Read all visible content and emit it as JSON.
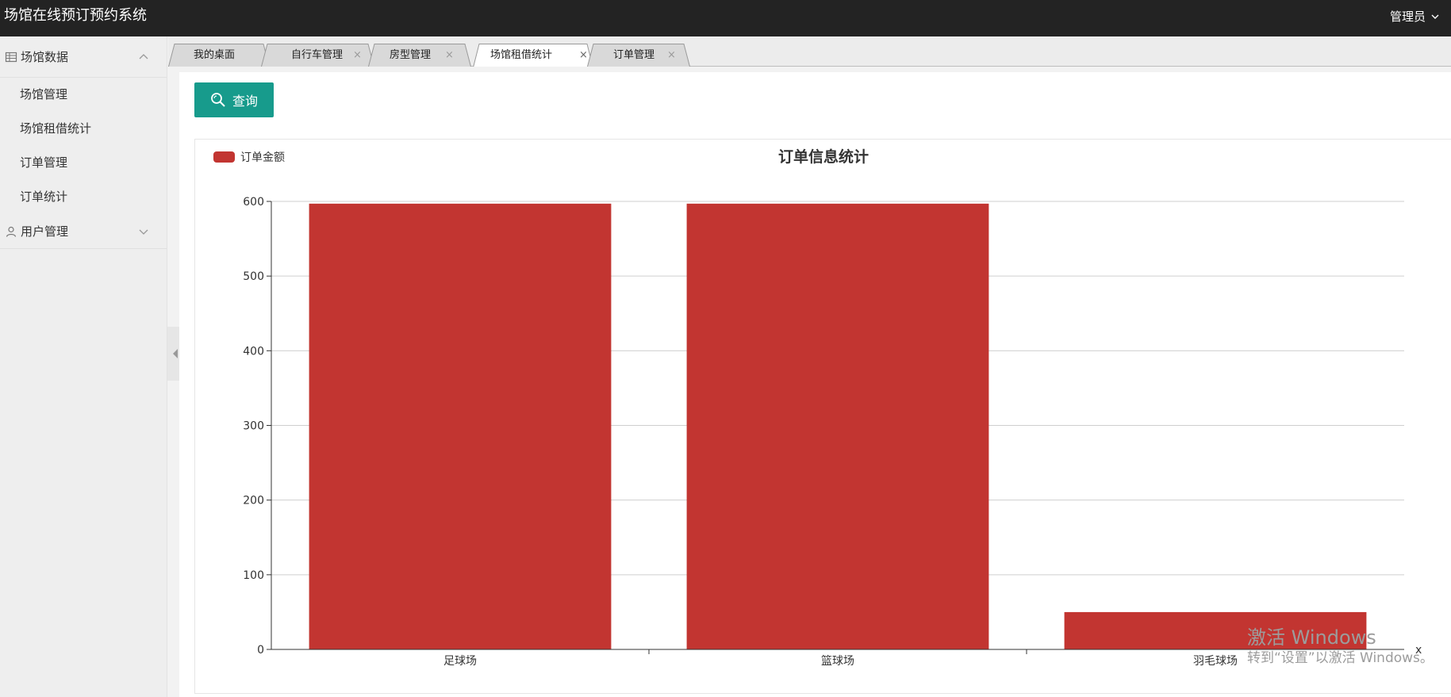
{
  "app": {
    "title": "场馆在线预订预约系统",
    "user": "管理员"
  },
  "sidebar": {
    "groups": [
      {
        "label": "场馆数据",
        "icon": "table-icon",
        "expanded": true,
        "items": [
          "场馆管理",
          "场馆租借统计",
          "订单管理",
          "订单统计"
        ]
      },
      {
        "label": "用户管理",
        "icon": "user-icon",
        "expanded": false,
        "items": []
      }
    ]
  },
  "tabs": [
    {
      "label": "我的桌面",
      "closable": false
    },
    {
      "label": "自行车管理",
      "closable": true
    },
    {
      "label": "房型管理",
      "closable": true
    },
    {
      "label": "场馆租借统计",
      "closable": true,
      "active": true
    },
    {
      "label": "订单管理",
      "closable": true
    }
  ],
  "toolbar": {
    "query_label": "查询",
    "accent": "#179b8c"
  },
  "chart_data": {
    "type": "bar",
    "title": "订单信息统计",
    "categories": [
      "足球场",
      "篮球场",
      "羽毛球场"
    ],
    "series": [
      {
        "name": "订单金额",
        "values": [
          597,
          597,
          50
        ],
        "color": "#c23531"
      }
    ],
    "xlabel": "x",
    "ylabel": "",
    "ylim": [
      0,
      600
    ],
    "yticks": [
      0,
      100,
      200,
      300,
      400,
      500,
      600
    ],
    "grid": true,
    "legend": "top-left"
  },
  "watermark": {
    "line1": "激活 Windows",
    "line2": "转到“设置”以激活 Windows。"
  }
}
